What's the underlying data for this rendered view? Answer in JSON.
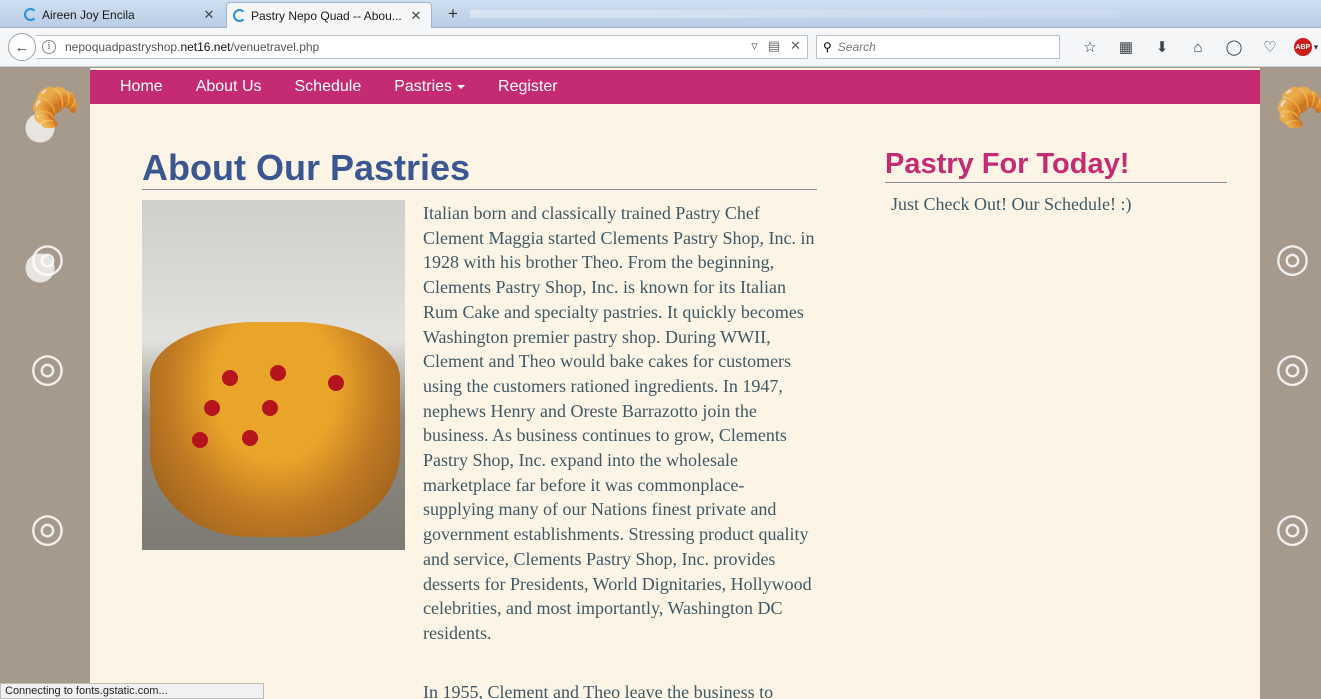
{
  "browser": {
    "tabs": [
      {
        "title": "Aireen Joy Encila",
        "active": false
      },
      {
        "title": "Pastry Nepo Quad -- Abou...",
        "active": true
      }
    ],
    "url_prefix": "nepoquadpastryshop.",
    "url_domain": "net16.net",
    "url_path": "/venuetravel.php",
    "search_placeholder": "Search",
    "status_text": "Connecting to fonts.gstatic.com...",
    "abp_label": "ABP"
  },
  "nav": {
    "items": [
      "Home",
      "About Us",
      "Schedule",
      "Pastries",
      "Register"
    ]
  },
  "main": {
    "title": "About Our Pastries",
    "paragraph1": "Italian born and classically trained Pastry Chef Clement Maggia started Clements Pastry Shop, Inc. in 1928 with his brother Theo. From the beginning, Clements Pastry Shop, Inc. is known for its Italian Rum Cake and specialty pastries. It quickly becomes Washington premier pastry shop. During WWII, Clement and Theo would bake cakes for customers using the customers rationed ingredients. In 1947, nephews Henry and Oreste Barrazotto join the business. As business continues to grow, Clements Pastry Shop, Inc. expand into the wholesale marketplace far before it was commonplace-supplying many of our Nations finest private and government establishments. Stressing product quality and service, Clements Pastry Shop, Inc. provides desserts for Presidents, World Dignitaries, Hollywood celebrities, and most importantly, Washington DC residents.",
    "paragraph2": "In 1955, Clement and Theo leave the business to"
  },
  "sidebar": {
    "title": "Pastry For Today!",
    "text": "Just Check Out! Our Schedule! :)"
  },
  "colors": {
    "menu_bg": "#c42b73",
    "title_blue": "#3a5792",
    "sidebar_pink": "#c42b73",
    "body_text": "#3f5866",
    "content_bg": "#fcf5e5"
  }
}
